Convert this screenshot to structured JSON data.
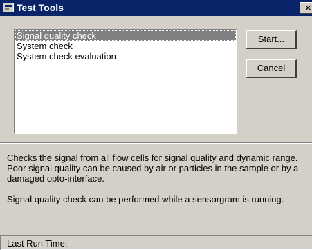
{
  "window": {
    "title": "Test Tools",
    "close_glyph": "✕",
    "icon": "app-icon"
  },
  "list": {
    "items": [
      {
        "label": "Signal quality check",
        "selected": true
      },
      {
        "label": "System check",
        "selected": false
      },
      {
        "label": "System check evaluation",
        "selected": false
      }
    ]
  },
  "buttons": {
    "start_label": "Start...",
    "cancel_label": "Cancel"
  },
  "description": {
    "lines": [
      "Checks the signal from all flow cells for signal quality and dynamic range.",
      "Poor signal quality can be caused by air or particles in the sample or by a",
      "damaged opto-interface."
    ],
    "note": "Signal quality check can be performed while a sensorgram is running."
  },
  "status": {
    "label": "Last Run Time:"
  },
  "colors": {
    "titlebar": "#0a246a",
    "window_bg": "#d4d0c8",
    "selection": "#808080"
  }
}
